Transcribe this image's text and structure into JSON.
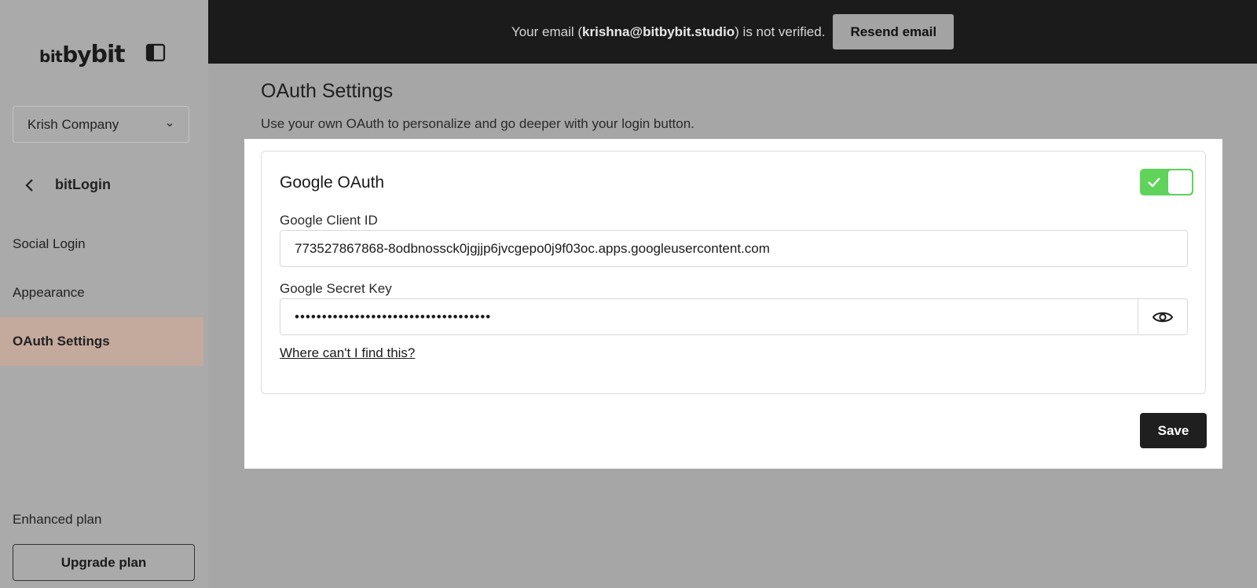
{
  "brand": {
    "logo_part1": "bit",
    "logo_part2": "by",
    "logo_part3": "bit"
  },
  "sidebar": {
    "company": "Krish Company",
    "section_title": "bitLogin",
    "items": [
      {
        "label": "Social Login",
        "active": false
      },
      {
        "label": "Appearance",
        "active": false
      },
      {
        "label": "OAuth Settings",
        "active": true
      }
    ],
    "plan_label": "Enhanced plan",
    "upgrade_label": "Upgrade plan"
  },
  "banner": {
    "prefix": "Your email (",
    "email": "krishna@bitbybit.studio",
    "suffix": ") is not verified.",
    "button_label": "Resend email"
  },
  "main": {
    "title": "OAuth Settings",
    "subtitle": "Use your own OAuth to personalize and go deeper with your login button.",
    "card": {
      "title": "Google OAuth",
      "enabled": true,
      "client_id_label": "Google Client ID",
      "client_id_value": "773527867868-8odbnossck0jgjjp6jvcgepo0j9f03oc.apps.googleusercontent.com",
      "secret_label": "Google Secret Key",
      "secret_value": "••••••••••••••••••••••••••••••••••••",
      "help_link": "Where can't I find this?"
    },
    "save_label": "Save"
  },
  "colors": {
    "banner_bg": "#1b1b1b",
    "active_nav_bg": "#c4a99d",
    "toggle_on": "#5fd35a",
    "save_bg": "#1f1f1f"
  }
}
